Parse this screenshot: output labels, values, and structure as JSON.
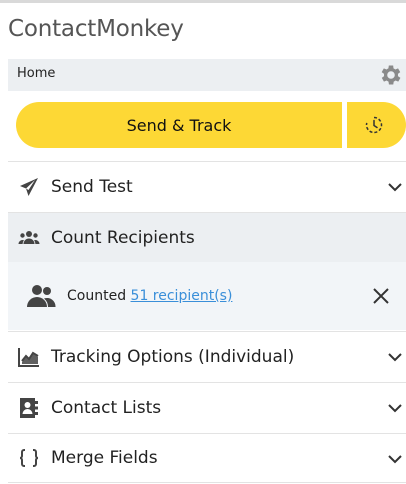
{
  "app": {
    "title": "ContactMonkey"
  },
  "breadcrumb": {
    "label": "Home"
  },
  "actions": {
    "send_track_label": "Send & Track"
  },
  "sections": {
    "send_test": "Send Test",
    "count_recipients": "Count Recipients",
    "tracking_options": "Tracking Options (Individual)",
    "contact_lists": "Contact Lists",
    "merge_fields": "Merge Fields"
  },
  "count_result": {
    "prefix": "Counted",
    "link": "51 recipient(s)"
  },
  "colors": {
    "accent_yellow": "#fdd835",
    "panel_bg": "#eceff2",
    "link_blue": "#3a8fd9",
    "icon_gray": "#444444"
  },
  "icons": {
    "settings": "gear-icon",
    "schedule": "clock-icon",
    "send_test": "paper-plane-icon",
    "count": "users-icon",
    "counted": "users-icon",
    "close": "close-icon",
    "tracking": "chart-line-icon",
    "contacts": "address-book-icon",
    "merge": "curly-braces-icon",
    "expand": "chevron-down-icon"
  }
}
